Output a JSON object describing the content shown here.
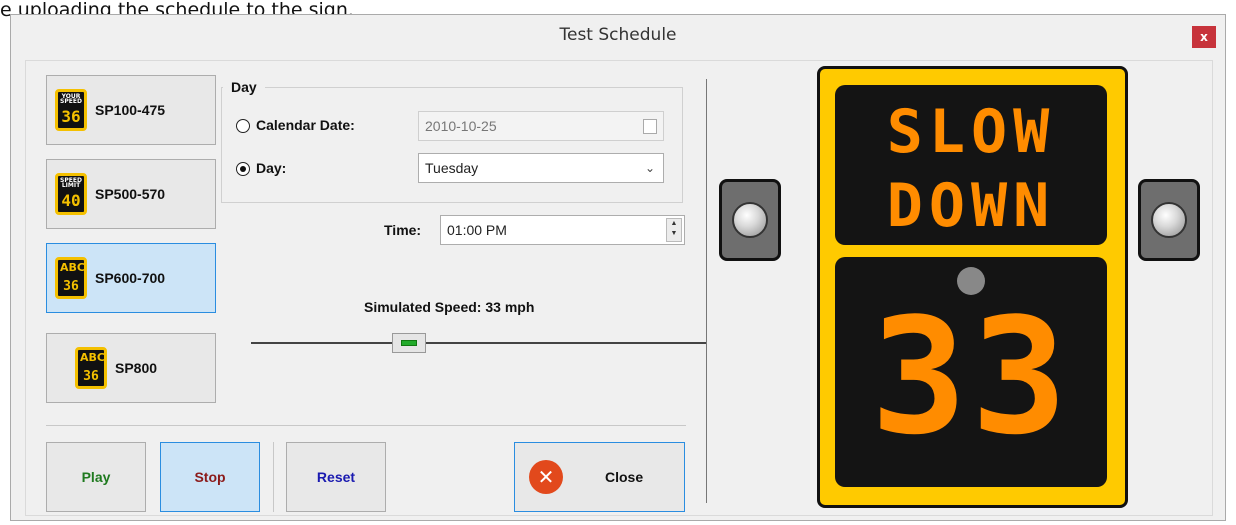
{
  "caption": "e uploading the schedule to the sign.",
  "window": {
    "title": "Test Schedule",
    "close_symbol": "x"
  },
  "models": [
    {
      "label": "SP100-475",
      "icon_top": "YOUR SPEED",
      "icon_num": "36",
      "icon": "your-speed-sign-icon"
    },
    {
      "label": "SP500-570",
      "icon_top": "SPEED LIMIT",
      "icon_num": "40",
      "icon": "speed-limit-sign-icon"
    },
    {
      "label": "SP600-700",
      "icon_top": "ABC",
      "icon_num": "36",
      "icon": "abc-sign-icon"
    },
    {
      "label": "SP800",
      "icon_top": "ABC",
      "icon_num": "36",
      "icon": "abc-sign-icon"
    }
  ],
  "selected_model": "SP600-700",
  "day_group": {
    "legend": "Day",
    "calendar_label": "Calendar Date:",
    "calendar_value": "2010-10-25",
    "day_label": "Day:",
    "day_value": "Tuesday",
    "selected": "Day:"
  },
  "time": {
    "label": "Time:",
    "value": "01:00 PM"
  },
  "speed": {
    "label": "Simulated Speed: 33 mph",
    "value_mph": 33
  },
  "buttons": {
    "play": "Play",
    "stop": "Stop",
    "reset": "Reset",
    "close": "Close"
  },
  "colors": {
    "play": "#1f7a1f",
    "stop": "#8b1a1a",
    "reset": "#1a1ab0",
    "sign_frame": "#ffca00",
    "led": "#ff8c00",
    "selected_bg": "#cce4f7"
  },
  "sign": {
    "line1": "SLOW",
    "line2": "DOWN",
    "speed": "33"
  }
}
